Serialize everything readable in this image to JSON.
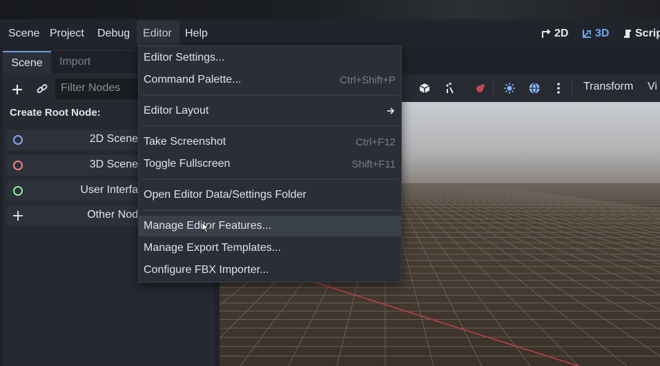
{
  "menubar": {
    "items": [
      "Scene",
      "Project",
      "Debug",
      "Editor",
      "Help"
    ],
    "workspaces": [
      "2D",
      "3D",
      "Scrip"
    ]
  },
  "dock": {
    "tabs": [
      "Scene",
      "Import"
    ],
    "filter_placeholder": "Filter Nodes",
    "create_root_label": "Create Root Node:",
    "nodes": [
      {
        "label": "2D Scene",
        "icon": "node2d-icon",
        "color": "#8da5f3"
      },
      {
        "label": "3D Scene",
        "icon": "node3d-icon",
        "color": "#fc7f7f"
      },
      {
        "label": "User Interfa",
        "icon": "control-icon",
        "color": "#8eef97"
      },
      {
        "label": "Other Nod",
        "icon": "add-icon",
        "color": "#e0e0e0"
      }
    ]
  },
  "viewport_toolbar": {
    "transform_label": "Transform",
    "view_label": "Vi"
  },
  "editor_menu": {
    "items": [
      {
        "label": "Editor Settings...",
        "shortcut": ""
      },
      {
        "label": "Command Palette...",
        "shortcut": "Ctrl+Shift+P"
      },
      {
        "label": "Editor Layout",
        "shortcut": "",
        "submenu": true
      },
      {
        "label": "Take Screenshot",
        "shortcut": "Ctrl+F12"
      },
      {
        "label": "Toggle Fullscreen",
        "shortcut": "Shift+F11"
      },
      {
        "label": "Open Editor Data/Settings Folder",
        "shortcut": ""
      },
      {
        "label": "Manage Editor Features...",
        "shortcut": "",
        "hovered": true
      },
      {
        "label": "Manage Export Templates...",
        "shortcut": ""
      },
      {
        "label": "Configure FBX Importer...",
        "shortcut": ""
      }
    ]
  },
  "colors": {
    "accent": "#6fa8f2",
    "grid_line": "#6e665c",
    "x_axis": "#c8404a",
    "sky_top": "#c9ccd2",
    "ground": "#3c342c"
  }
}
